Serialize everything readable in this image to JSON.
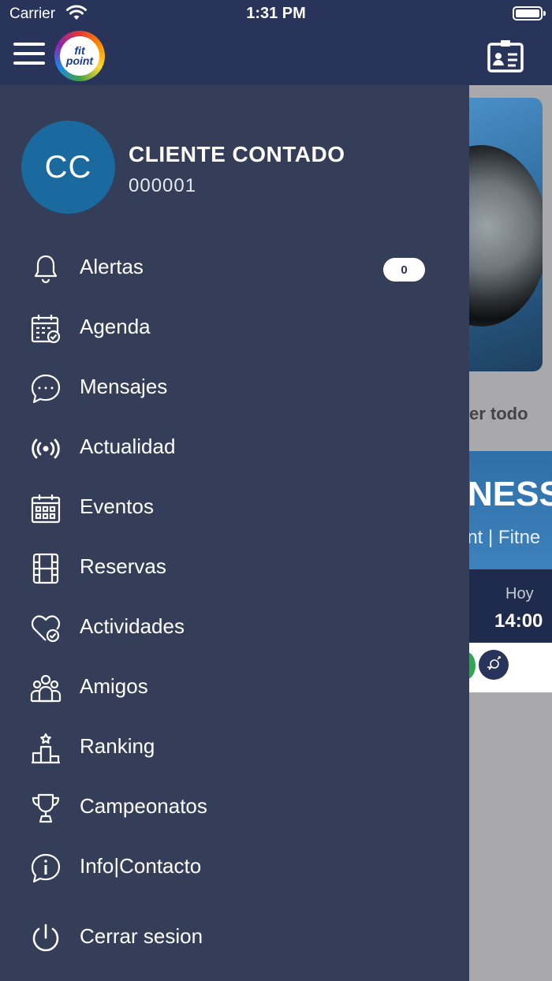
{
  "status_bar": {
    "carrier": "Carrier",
    "time": "1:31 PM"
  },
  "header": {
    "logo_line1": "fit",
    "logo_line2": "point"
  },
  "profile": {
    "initials": "CC",
    "name": "CLIENTE CONTADO",
    "id": "000001"
  },
  "menu": {
    "items": [
      {
        "label": "Alertas",
        "icon": "bell-icon",
        "badge": "0"
      },
      {
        "label": "Agenda",
        "icon": "calendar-check-icon"
      },
      {
        "label": "Mensajes",
        "icon": "chat-bubble-icon"
      },
      {
        "label": "Actualidad",
        "icon": "broadcast-icon"
      },
      {
        "label": "Eventos",
        "icon": "calendar-grid-icon"
      },
      {
        "label": "Reservas",
        "icon": "film-icon"
      },
      {
        "label": "Actividades",
        "icon": "heart-check-icon"
      },
      {
        "label": "Amigos",
        "icon": "group-icon"
      },
      {
        "label": "Ranking",
        "icon": "podium-icon"
      },
      {
        "label": "Campeonatos",
        "icon": "trophy-icon"
      },
      {
        "label": "Info|Contacto",
        "icon": "info-bubble-icon"
      },
      {
        "label": "Cerrar sesion",
        "icon": "power-icon"
      }
    ]
  },
  "background": {
    "see_all": "er todo",
    "card_title": "NESS",
    "card_subtitle": "int | Fitne",
    "day": "Hoy",
    "hour": "14:00"
  },
  "colors": {
    "topbar": "#283459",
    "drawer": "#343e58",
    "avatar": "#1a6aa0"
  }
}
